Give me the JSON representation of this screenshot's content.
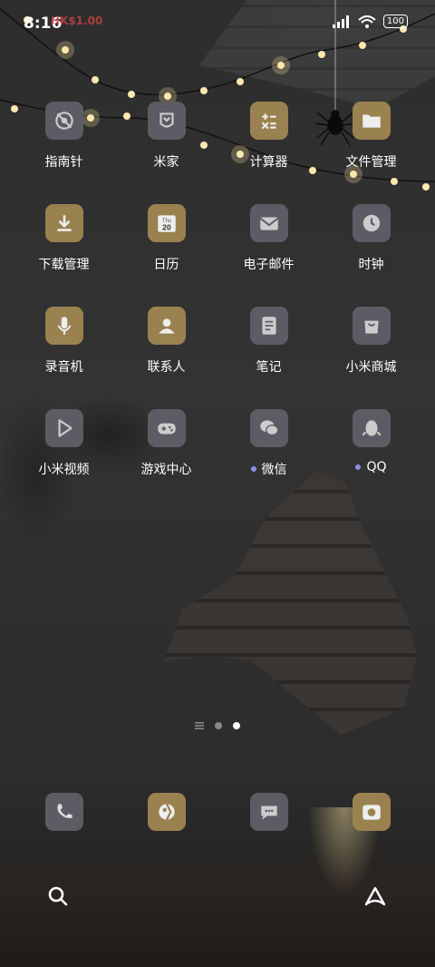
{
  "status_bar": {
    "time": "8:16",
    "price_tag": "HK$1.00",
    "battery": "100"
  },
  "apps": [
    {
      "label": "指南针",
      "icon": "compass-icon",
      "style": "grey",
      "dot": false
    },
    {
      "label": "米家",
      "icon": "mijia-icon",
      "style": "grey",
      "dot": false
    },
    {
      "label": "计算器",
      "icon": "calculator-icon",
      "style": "gold",
      "dot": false
    },
    {
      "label": "文件管理",
      "icon": "folder-icon",
      "style": "gold",
      "dot": false
    },
    {
      "label": "下载管理",
      "icon": "download-icon",
      "style": "gold",
      "dot": false
    },
    {
      "label": "日历",
      "icon": "calendar-icon",
      "style": "gold",
      "dot": false,
      "icon_text_top": "Thu",
      "icon_text_bottom": "20"
    },
    {
      "label": "电子邮件",
      "icon": "mail-icon",
      "style": "grey",
      "dot": false
    },
    {
      "label": "时钟",
      "icon": "clock-icon",
      "style": "grey",
      "dot": false
    },
    {
      "label": "录音机",
      "icon": "microphone-icon",
      "style": "gold",
      "dot": false
    },
    {
      "label": "联系人",
      "icon": "contacts-icon",
      "style": "gold",
      "dot": false
    },
    {
      "label": "笔记",
      "icon": "notes-icon",
      "style": "grey",
      "dot": false
    },
    {
      "label": "小米商城",
      "icon": "shopping-bag-icon",
      "style": "grey",
      "dot": false
    },
    {
      "label": "小米视频",
      "icon": "play-icon",
      "style": "grey",
      "dot": false
    },
    {
      "label": "游戏中心",
      "icon": "gamepad-icon",
      "style": "grey",
      "dot": false
    },
    {
      "label": "微信",
      "icon": "wechat-icon",
      "style": "grey",
      "dot": true
    },
    {
      "label": "QQ",
      "icon": "qq-penguin-icon",
      "style": "grey",
      "dot": true
    }
  ],
  "dock": [
    {
      "icon": "phone-icon",
      "style": "grey"
    },
    {
      "icon": "browser-icon",
      "style": "gold"
    },
    {
      "icon": "messages-icon",
      "style": "grey"
    },
    {
      "icon": "camera-icon",
      "style": "gold"
    }
  ],
  "pager": {
    "pages": 2,
    "active": 2
  },
  "colors": {
    "gold": "#9a8150",
    "grey": "#5c5c64",
    "notification_dot": "#8e8ce8"
  }
}
